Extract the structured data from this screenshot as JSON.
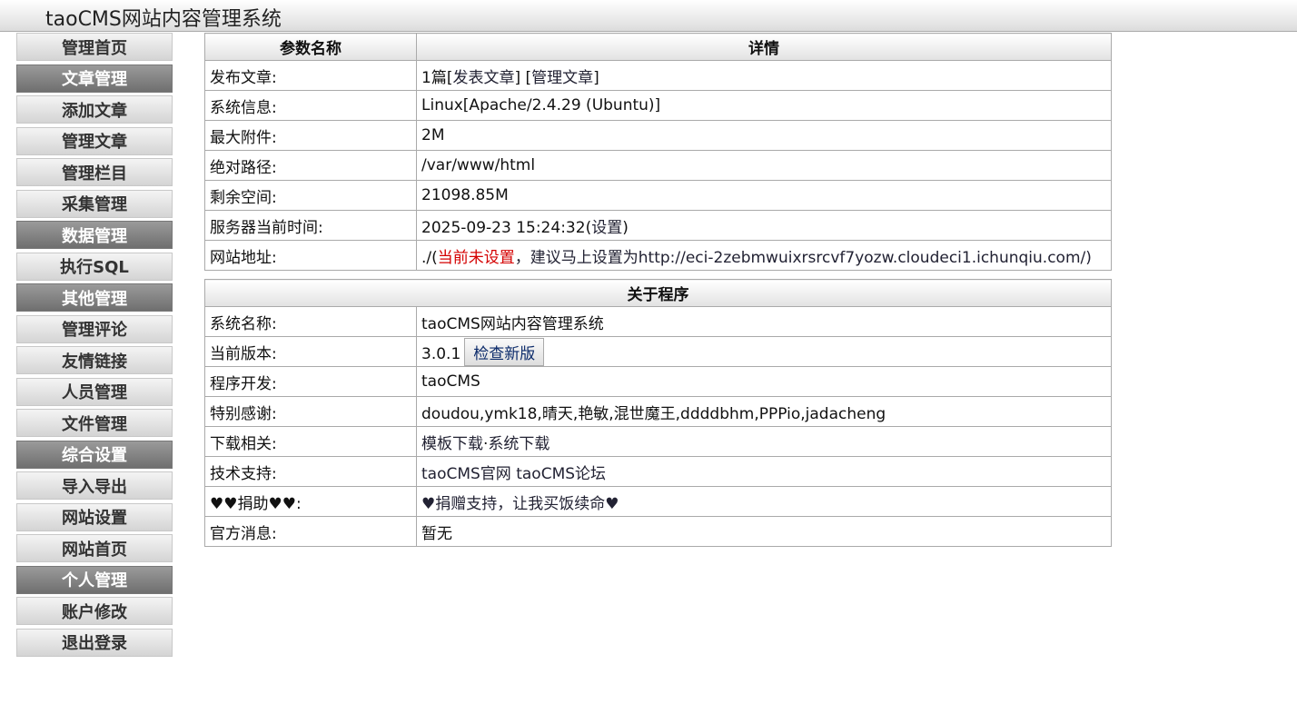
{
  "app": {
    "title": "taoCMS网站内容管理系统"
  },
  "sidebar": {
    "items": [
      {
        "label": "管理首页",
        "type": "link"
      },
      {
        "label": "文章管理",
        "type": "head"
      },
      {
        "label": "添加文章",
        "type": "link"
      },
      {
        "label": "管理文章",
        "type": "link"
      },
      {
        "label": "管理栏目",
        "type": "link"
      },
      {
        "label": "采集管理",
        "type": "link"
      },
      {
        "label": "数据管理",
        "type": "head"
      },
      {
        "label": "执行SQL",
        "type": "link"
      },
      {
        "label": "其他管理",
        "type": "head"
      },
      {
        "label": "管理评论",
        "type": "link"
      },
      {
        "label": "友情链接",
        "type": "link"
      },
      {
        "label": "人员管理",
        "type": "link"
      },
      {
        "label": "文件管理",
        "type": "link"
      },
      {
        "label": "综合设置",
        "type": "head"
      },
      {
        "label": "导入导出",
        "type": "link"
      },
      {
        "label": "网站设置",
        "type": "link"
      },
      {
        "label": "网站首页",
        "type": "link"
      },
      {
        "label": "个人管理",
        "type": "head"
      },
      {
        "label": "账户修改",
        "type": "link"
      },
      {
        "label": "退出登录",
        "type": "link"
      }
    ]
  },
  "info": {
    "header_param": "参数名称",
    "header_detail": "详情",
    "publish": {
      "label": "发布文章:",
      "count": "1篇",
      "bracket_open": "[",
      "publish_link": "发表文章",
      "mid": "] [",
      "manage_link": "管理文章",
      "bracket_close": "]"
    },
    "system": {
      "label": "系统信息:",
      "value": "Linux[Apache/2.4.29 (Ubuntu)]"
    },
    "max_attach": {
      "label": "最大附件:",
      "value": "2M"
    },
    "abs_path": {
      "label": "绝对路径:",
      "value": "/var/www/html"
    },
    "free_space": {
      "label": "剩余空间:",
      "value": "21098.85M"
    },
    "server_time": {
      "label": "服务器当前时间:",
      "value": "2025-09-23 15:24:32",
      "open": "(",
      "link": "设置",
      "close": ")"
    },
    "site_url": {
      "label": "网站地址:",
      "prefix": "./(",
      "warn": "当前未设置",
      "rest": "，建议马上设置为http://eci-2zebmwuixrsrcvf7yozw.cloudeci1.ichunqiu.com/)"
    }
  },
  "about": {
    "header": "关于程序",
    "sys_name": {
      "label": "系统名称:",
      "value": "taoCMS网站内容管理系统"
    },
    "version": {
      "label": "当前版本:",
      "value": "3.0.1",
      "button": "检查新版"
    },
    "developer": {
      "label": "程序开发:",
      "value": "taoCMS"
    },
    "thanks": {
      "label": "特别感谢:",
      "value": "doudou,ymk18,晴天,艳敏,混世魔王,ddddbhm,PPPio,jadacheng"
    },
    "download": {
      "label": "下载相关:",
      "link1": "模板下载",
      "sep": "·",
      "link2": "系统下载"
    },
    "support": {
      "label": "技术支持:",
      "link1": "taoCMS官网",
      "link2": "taoCMS论坛"
    },
    "donate": {
      "label": "♥♥捐助♥♥:",
      "link": "♥捐赠支持，让我买饭续命♥"
    },
    "news": {
      "label": "官方消息:",
      "value": "暂无"
    }
  }
}
